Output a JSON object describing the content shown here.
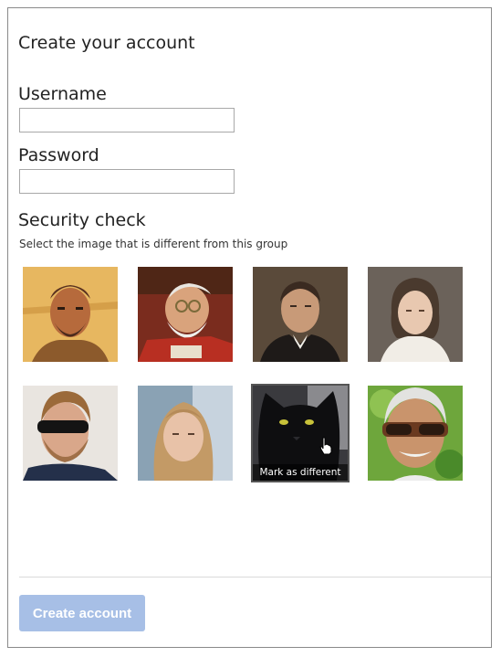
{
  "form": {
    "title": "Create your account",
    "username_label": "Username",
    "username_value": "",
    "password_label": "Password",
    "password_value": ""
  },
  "security": {
    "title": "Security check",
    "instruction": "Select the image that is different from this group",
    "images": [
      {
        "icon": "painting-bearded-man-icon"
      },
      {
        "icon": "painting-man-with-spectacles-icon"
      },
      {
        "icon": "portrait-man-dark-coat-icon"
      },
      {
        "icon": "portrait-child-icon"
      },
      {
        "icon": "photo-man-sunglasses-icon"
      },
      {
        "icon": "photo-young-woman-icon"
      },
      {
        "icon": "photo-black-cat-icon",
        "overlay": "Mark as different"
      },
      {
        "icon": "photo-older-man-sunglasses-icon"
      }
    ]
  },
  "submit": {
    "label": "Create account",
    "color": "#a7bfe6"
  }
}
